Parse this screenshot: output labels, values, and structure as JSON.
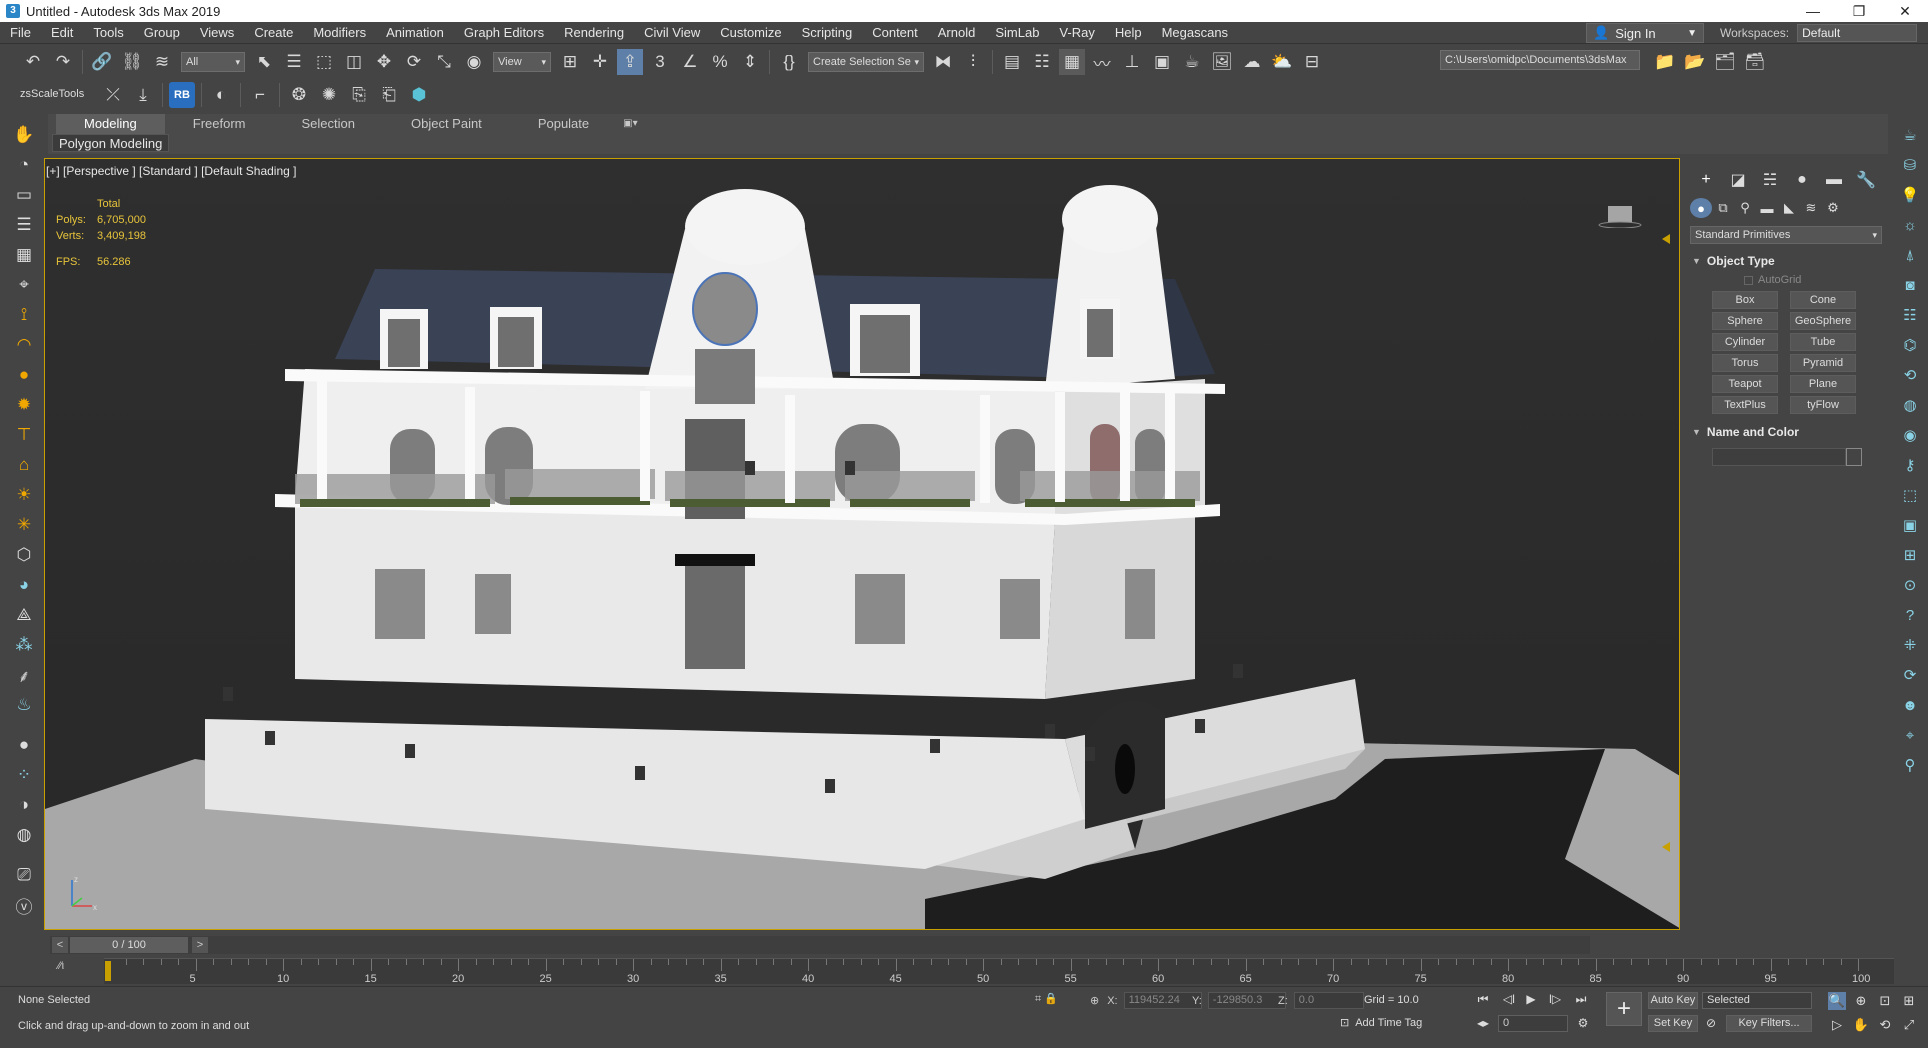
{
  "window": {
    "title": "Untitled - Autodesk 3ds Max 2019",
    "app_icon": "3",
    "min_icon": "—",
    "max_icon": "❐",
    "close_icon": "✕"
  },
  "menu": [
    "File",
    "Edit",
    "Tools",
    "Group",
    "Views",
    "Create",
    "Modifiers",
    "Animation",
    "Graph Editors",
    "Rendering",
    "Civil View",
    "Customize",
    "Scripting",
    "Content",
    "Arnold",
    "SimLab",
    "V-Ray",
    "Help",
    "Megascans"
  ],
  "signin": {
    "label": "Sign In"
  },
  "workspaces": {
    "label": "Workspaces:",
    "value": "Default"
  },
  "main_toolbar": {
    "selection_filter": "All",
    "ref_coord": "View",
    "named_selection": "Create Selection Se",
    "path": "C:\\Users\\omidpc\\Documents\\3dsMax"
  },
  "secondary_toolbar": {
    "label": "zsScaleTools"
  },
  "ribbon": {
    "tabs": [
      "Modeling",
      "Freeform",
      "Selection",
      "Object Paint",
      "Populate"
    ],
    "active_tab": "Modeling",
    "panel_label": "Polygon Modeling"
  },
  "viewport": {
    "label": "[+] [Perspective ] [Standard ] [Default Shading ]",
    "stats": {
      "header": "Total",
      "polys_label": "Polys:",
      "polys": "6,705,000",
      "verts_label": "Verts:",
      "verts": "3,409,198",
      "fps_label": "FPS:",
      "fps": "56.286"
    },
    "axis_labels": {
      "x": "x",
      "z": "z"
    }
  },
  "command_panel": {
    "category": "Standard Primitives",
    "object_type_header": "Object Type",
    "autogrid_label": "AutoGrid",
    "object_buttons": [
      "Box",
      "Cone",
      "Sphere",
      "GeoSphere",
      "Cylinder",
      "Tube",
      "Torus",
      "Pyramid",
      "Teapot",
      "Plane",
      "TextPlus",
      "tyFlow"
    ],
    "name_color_header": "Name and Color",
    "name_value": ""
  },
  "timeline": {
    "frame_display": "0 / 100",
    "ticks": [
      5,
      10,
      15,
      20,
      25,
      30,
      35,
      40,
      45,
      50,
      55,
      60,
      65,
      70,
      75,
      80,
      85,
      90,
      95,
      100
    ]
  },
  "status": {
    "selection": "None Selected",
    "prompt": "Click and drag up-and-down to zoom in and out",
    "x_label": "X:",
    "x_value": "119452.24",
    "y_label": "Y:",
    "y_value": "-129850.3",
    "z_label": "Z:",
    "z_value": "0.0",
    "grid": "Grid = 10.0",
    "add_time_tag": "Add Time Tag",
    "auto_key": "Auto Key",
    "set_key": "Set Key",
    "key_mode": "Selected",
    "key_filters": "Key Filters...",
    "current_frame": "0"
  },
  "colors": {
    "viewport_border": "#c8a000",
    "stats_text": "#e8c43a",
    "panel_bg": "#444444",
    "accent_blue": "#5d7fa8"
  }
}
